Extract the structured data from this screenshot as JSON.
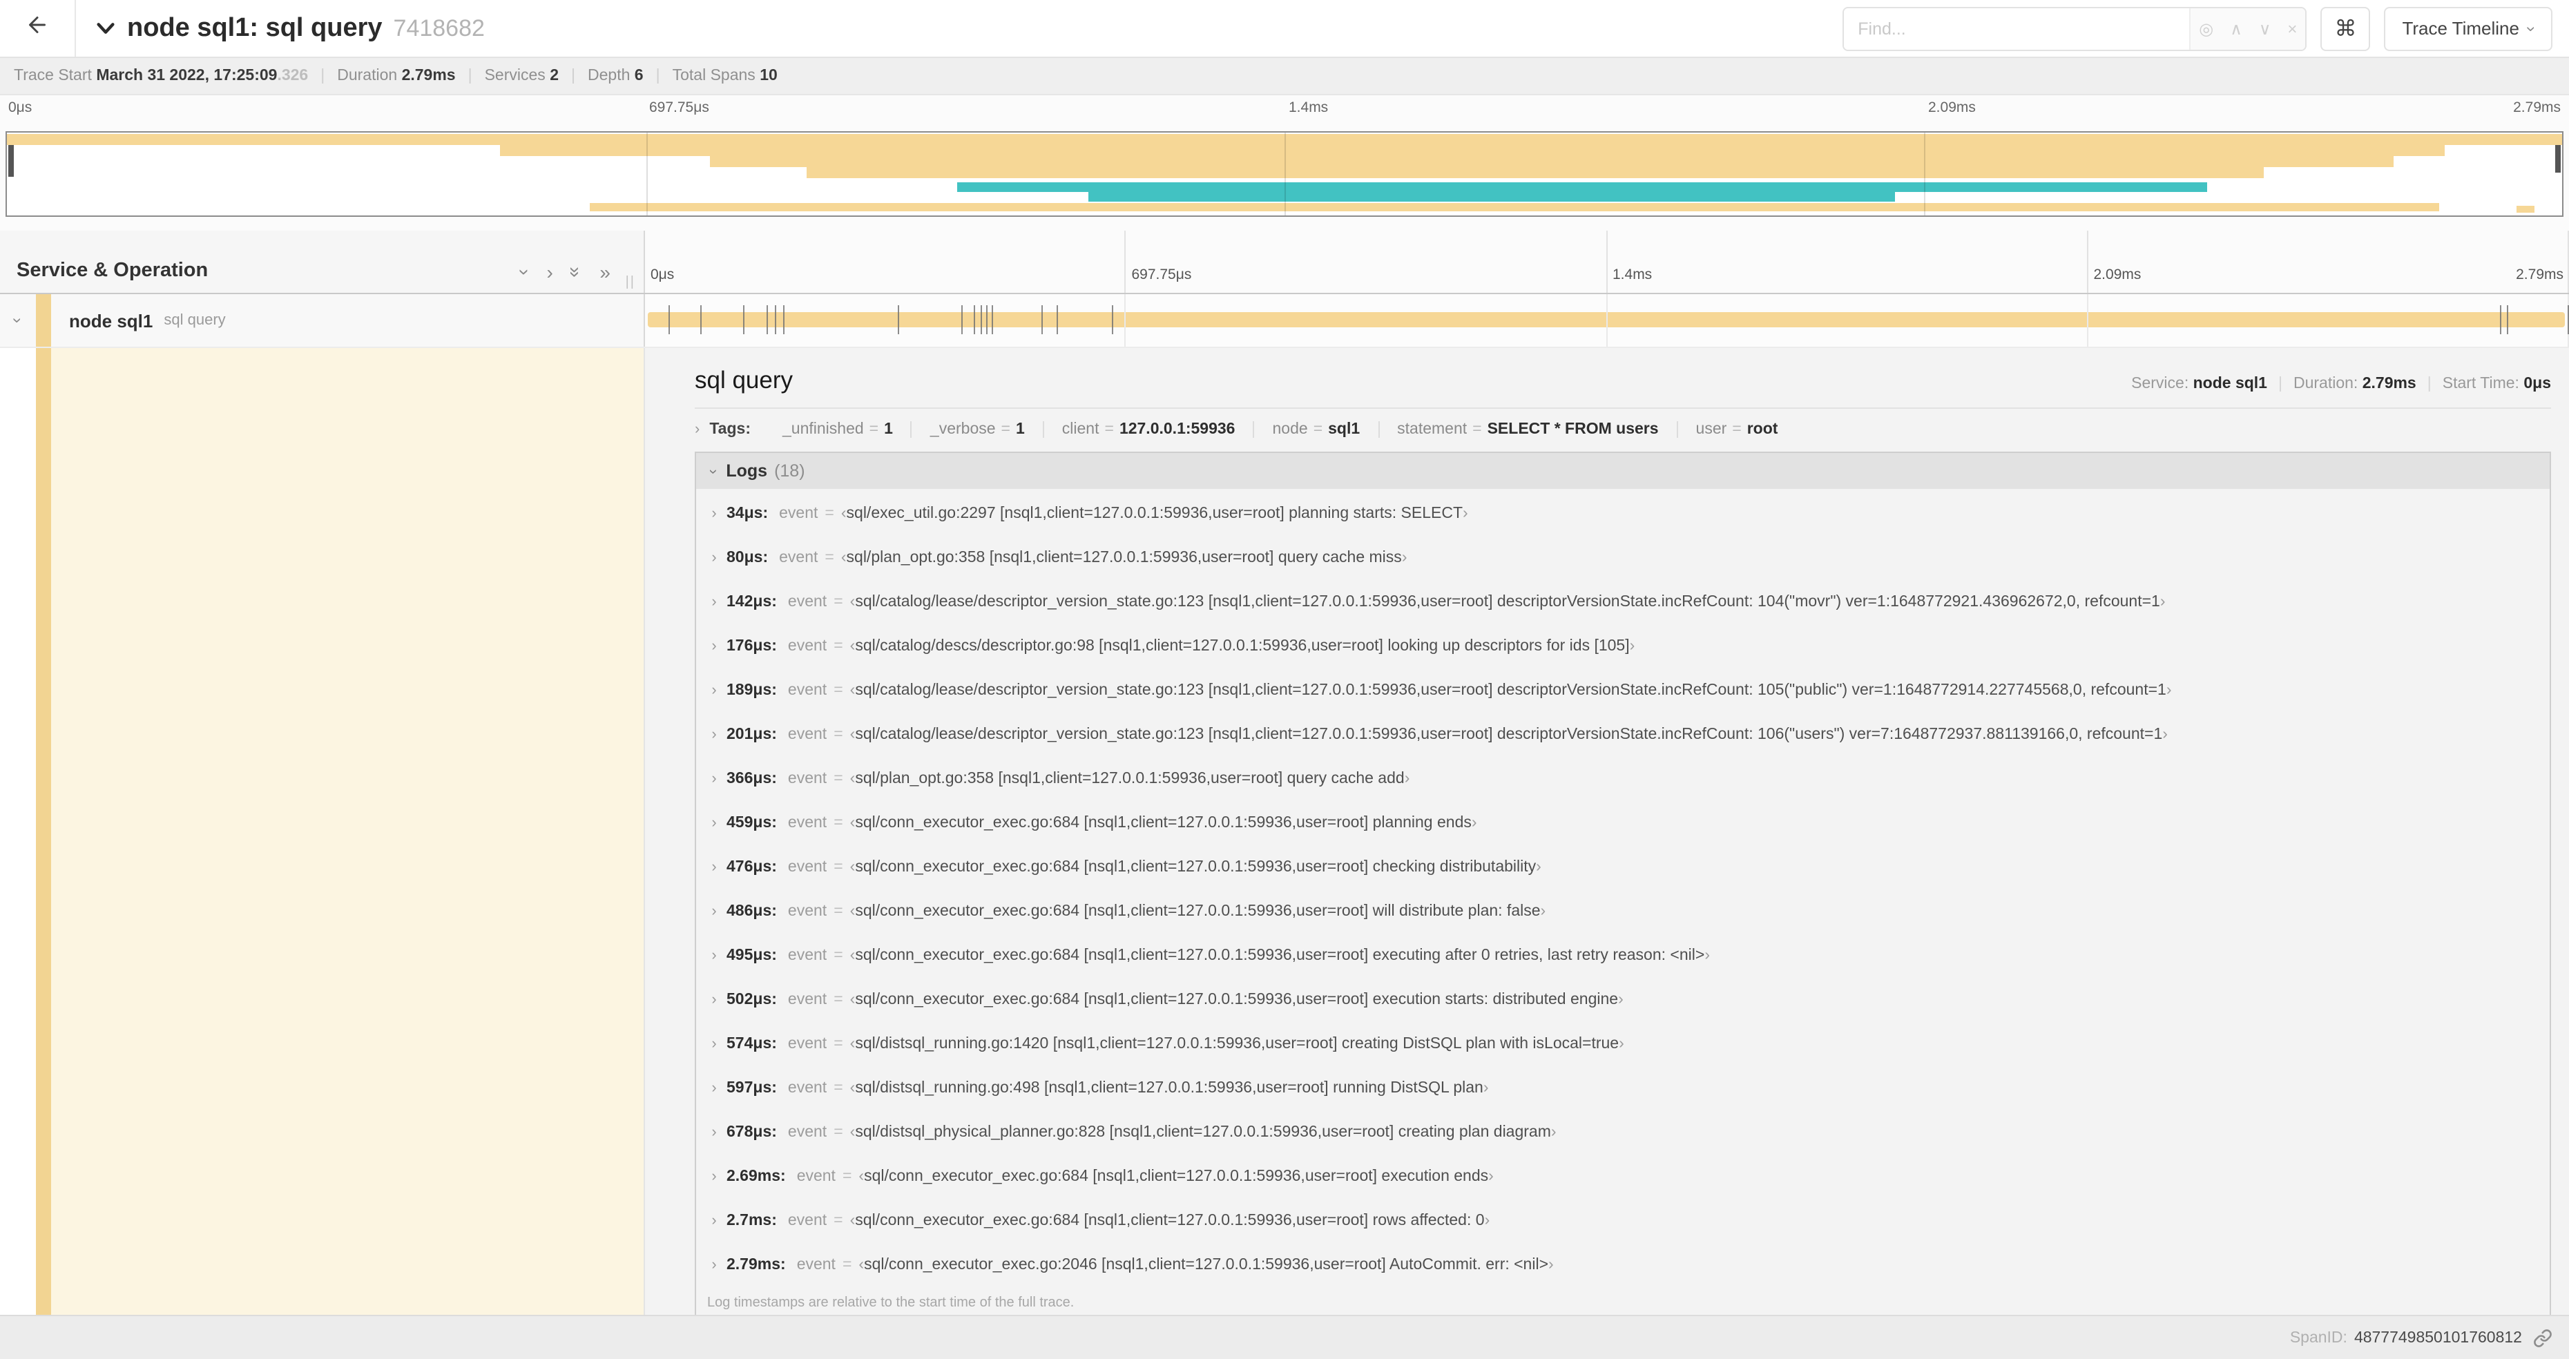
{
  "colors": {
    "span_tan": "#f6d796",
    "span_teal": "#42c2c2",
    "accent_strip": "#f2d492",
    "detail_cream": "#fcf5e1"
  },
  "icons": {
    "back": "arrow-left",
    "title_chevron": "chevron-down",
    "target": "◎",
    "prev": "∧",
    "next": "∨",
    "clear": "×",
    "cmd": "⌘",
    "chevron_right": "›",
    "chevron_double": "»",
    "grip": "||"
  },
  "header": {
    "title": "node sql1: sql query",
    "trace_id": "7418682",
    "find_placeholder": "Find...",
    "view_button": "Trace Timeline"
  },
  "trace_info": {
    "items": [
      {
        "label": "Trace Start",
        "value": "March 31 2022, 17:25:09",
        "suffix": ".326"
      },
      {
        "label": "Duration",
        "value": "2.79ms"
      },
      {
        "label": "Services",
        "value": "2"
      },
      {
        "label": "Depth",
        "value": "6"
      },
      {
        "label": "Total Spans",
        "value": "10"
      }
    ]
  },
  "minimap": {
    "ticks": [
      "0μs",
      "697.75μs",
      "1.4ms",
      "2.09ms",
      "2.79ms"
    ],
    "grid_pcts": [
      25,
      50,
      75
    ],
    "bars": [
      {
        "color": "tan",
        "l": 0,
        "w": 100,
        "t": 1,
        "h": 8
      },
      {
        "color": "tan",
        "l": 19.3,
        "w": 76.1,
        "t": 9,
        "h": 8
      },
      {
        "color": "tan",
        "l": 27.5,
        "w": 65.9,
        "t": 17,
        "h": 8
      },
      {
        "color": "tan",
        "l": 31.3,
        "w": 57.0,
        "t": 25,
        "h": 8
      },
      {
        "color": "teal",
        "l": 37.2,
        "w": 48.9,
        "t": 36,
        "h": 7
      },
      {
        "color": "teal",
        "l": 42.3,
        "w": 31.6,
        "t": 43,
        "h": 7
      },
      {
        "color": "tan",
        "l": 22.8,
        "w": 72.4,
        "t": 51,
        "h": 6
      },
      {
        "color": "tan",
        "l": 98.2,
        "w": 0.7,
        "t": 53,
        "h": 5
      }
    ]
  },
  "timeline": {
    "left_header": "Service & Operation",
    "ticks": [
      "0μs",
      "697.75μs",
      "1.4ms",
      "2.09ms",
      "2.79ms"
    ],
    "grid_pcts": [
      25,
      50,
      75,
      100
    ]
  },
  "span_row": {
    "service": "node sql1",
    "operation": "sql query",
    "log_marker_pcts": [
      1.22,
      2.87,
      5.09,
      6.31,
      6.77,
      7.2,
      13.12,
      16.45,
      17.06,
      17.42,
      17.74,
      17.99,
      20.57,
      21.4,
      24.3,
      96.42,
      96.77,
      99.93
    ]
  },
  "detail": {
    "title": "sql query",
    "meta": [
      {
        "label": "Service:",
        "value": "node sql1"
      },
      {
        "label": "Duration:",
        "value": "2.79ms"
      },
      {
        "label": "Start Time:",
        "value": "0μs"
      }
    ],
    "tags_label": "Tags:",
    "tags": [
      {
        "key": "_unfinished",
        "value": "1"
      },
      {
        "key": "_verbose",
        "value": "1"
      },
      {
        "key": "client",
        "value": "127.0.0.1:59936"
      },
      {
        "key": "node",
        "value": "sql1"
      },
      {
        "key": "statement",
        "value": "SELECT * FROM users"
      },
      {
        "key": "user",
        "value": "root"
      }
    ],
    "logs_label": "Logs",
    "logs_count": "(18)",
    "log_field": "event",
    "logs": [
      {
        "time": "34μs:",
        "message": "sql/exec_util.go:2297 [nsql1,client=127.0.0.1:59936,user=root] planning starts: SELECT"
      },
      {
        "time": "80μs:",
        "message": "sql/plan_opt.go:358 [nsql1,client=127.0.0.1:59936,user=root] query cache miss"
      },
      {
        "time": "142μs:",
        "message": "sql/catalog/lease/descriptor_version_state.go:123 [nsql1,client=127.0.0.1:59936,user=root] descriptorVersionState.incRefCount: 104(\"movr\") ver=1:1648772921.436962672,0, refcount=1"
      },
      {
        "time": "176μs:",
        "message": "sql/catalog/descs/descriptor.go:98 [nsql1,client=127.0.0.1:59936,user=root] looking up descriptors for ids [105]"
      },
      {
        "time": "189μs:",
        "message": "sql/catalog/lease/descriptor_version_state.go:123 [nsql1,client=127.0.0.1:59936,user=root] descriptorVersionState.incRefCount: 105(\"public\") ver=1:1648772914.227745568,0, refcount=1"
      },
      {
        "time": "201μs:",
        "message": "sql/catalog/lease/descriptor_version_state.go:123 [nsql1,client=127.0.0.1:59936,user=root] descriptorVersionState.incRefCount: 106(\"users\") ver=7:1648772937.881139166,0, refcount=1"
      },
      {
        "time": "366μs:",
        "message": "sql/plan_opt.go:358 [nsql1,client=127.0.0.1:59936,user=root] query cache add"
      },
      {
        "time": "459μs:",
        "message": "sql/conn_executor_exec.go:684 [nsql1,client=127.0.0.1:59936,user=root] planning ends"
      },
      {
        "time": "476μs:",
        "message": "sql/conn_executor_exec.go:684 [nsql1,client=127.0.0.1:59936,user=root] checking distributability"
      },
      {
        "time": "486μs:",
        "message": "sql/conn_executor_exec.go:684 [nsql1,client=127.0.0.1:59936,user=root] will distribute plan: false"
      },
      {
        "time": "495μs:",
        "message": "sql/conn_executor_exec.go:684 [nsql1,client=127.0.0.1:59936,user=root] executing after 0 retries, last retry reason: <nil>"
      },
      {
        "time": "502μs:",
        "message": "sql/conn_executor_exec.go:684 [nsql1,client=127.0.0.1:59936,user=root] execution starts: distributed engine"
      },
      {
        "time": "574μs:",
        "message": "sql/distsql_running.go:1420 [nsql1,client=127.0.0.1:59936,user=root] creating DistSQL plan with isLocal=true"
      },
      {
        "time": "597μs:",
        "message": "sql/distsql_running.go:498 [nsql1,client=127.0.0.1:59936,user=root] running DistSQL plan"
      },
      {
        "time": "678μs:",
        "message": "sql/distsql_physical_planner.go:828 [nsql1,client=127.0.0.1:59936,user=root] creating plan diagram"
      },
      {
        "time": "2.69ms:",
        "message": "sql/conn_executor_exec.go:684 [nsql1,client=127.0.0.1:59936,user=root] execution ends"
      },
      {
        "time": "2.7ms:",
        "message": "sql/conn_executor_exec.go:684 [nsql1,client=127.0.0.1:59936,user=root] rows affected: 0"
      },
      {
        "time": "2.79ms:",
        "message": "sql/conn_executor_exec.go:2046 [nsql1,client=127.0.0.1:59936,user=root] AutoCommit. err: <nil>"
      }
    ],
    "footer_note": "Log timestamps are relative to the start time of the full trace."
  },
  "footer": {
    "spanid_label": "SpanID:",
    "spanid_value": "4877749850101760812"
  }
}
